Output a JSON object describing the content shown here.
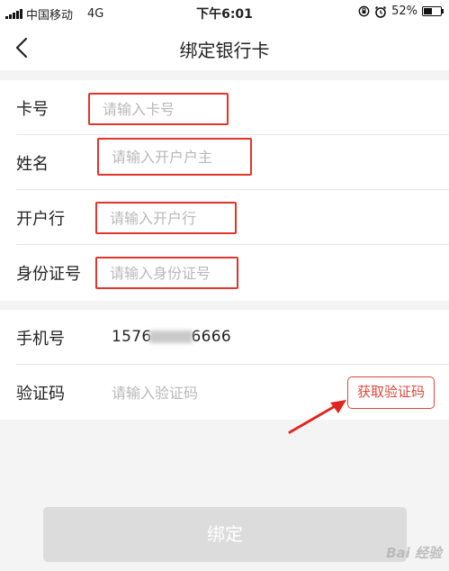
{
  "status_bar": {
    "carrier": "中国移动",
    "network": "4G",
    "time": "下午6:01",
    "battery_text": "52%",
    "battery_level": 0.52
  },
  "nav": {
    "title": "绑定银行卡"
  },
  "form": {
    "card_number": {
      "label": "卡号",
      "placeholder": "请输入卡号"
    },
    "name": {
      "label": "姓名",
      "placeholder": "请输入开户户主"
    },
    "bank": {
      "label": "开户行",
      "placeholder": "请输入开户行"
    },
    "id_number": {
      "label": "身份证号",
      "placeholder": "请输入身份证号"
    },
    "phone": {
      "label": "手机号",
      "value_prefix": "1576",
      "value_suffix": "6666"
    },
    "verify_code": {
      "label": "验证码",
      "placeholder": "请输入验证码",
      "button": "获取验证码"
    }
  },
  "submit": {
    "label": "绑定"
  },
  "watermark": "Bai 经验",
  "colors": {
    "accent": "#e0342f",
    "button_disabled": "#dcdcdc",
    "background": "#f4f4f4"
  },
  "icons": {
    "back": "chevron-left-icon",
    "annotation_arrow": "arrow-icon"
  }
}
